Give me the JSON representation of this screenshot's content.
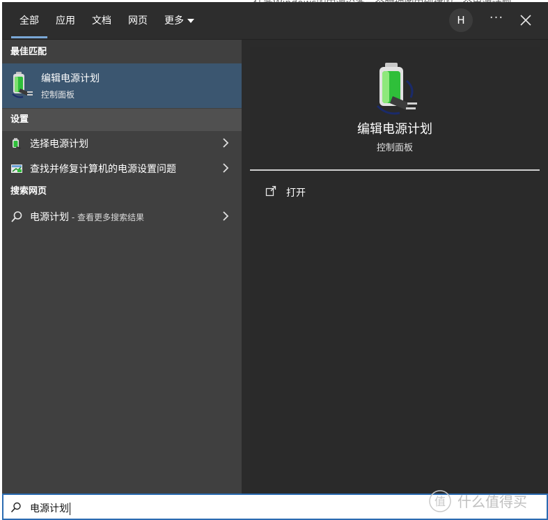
{
  "background_text": "…任务Windows的中源设备一个物理图中创建的一个电源计划",
  "tabs": [
    {
      "label": "全部",
      "active": true
    },
    {
      "label": "应用"
    },
    {
      "label": "文档"
    },
    {
      "label": "网页"
    },
    {
      "label": "更多"
    }
  ],
  "top_right": {
    "avatar_letter": "H",
    "more_label": "···"
  },
  "best_match": {
    "header": "最佳匹配",
    "title": "编辑电源计划",
    "subtitle": "控制面板"
  },
  "settings": {
    "header": "设置",
    "items": [
      {
        "label": "选择电源计划",
        "icon": "battery-icon"
      },
      {
        "label": "查找并修复计算机的电源设置问题",
        "icon": "troubleshoot-icon"
      }
    ]
  },
  "web": {
    "header": "搜索网页",
    "item_label": "电源计划",
    "item_suffix": " - 查看更多搜索结果"
  },
  "preview": {
    "title": "编辑电源计划",
    "subtitle": "控制面板",
    "action_label": "打开"
  },
  "search": {
    "value": "电源计划"
  },
  "watermark": {
    "text": "什么值得买"
  },
  "colors": {
    "selected": "#3b5670",
    "accent": "#2b6bb1",
    "panel_bg": "#2b2b2b",
    "left_bg": "#404040"
  }
}
